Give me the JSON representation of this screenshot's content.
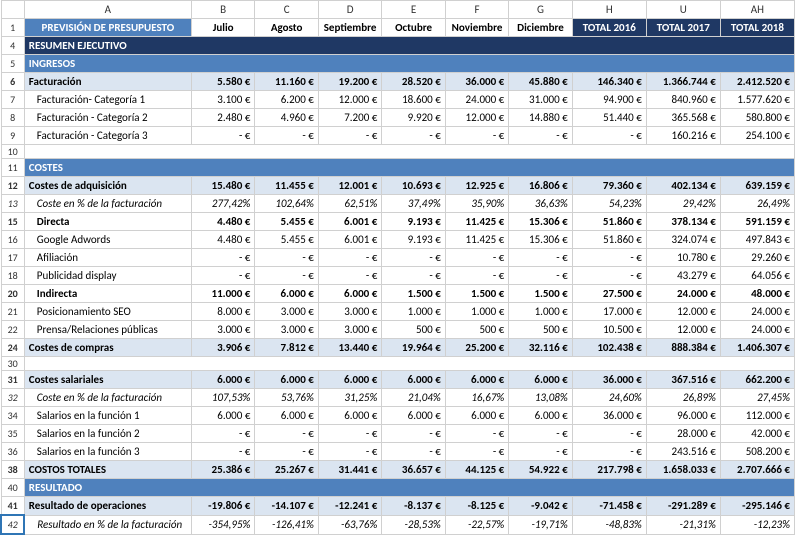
{
  "columns": [
    "A",
    "B",
    "C",
    "D",
    "E",
    "F",
    "G",
    "H",
    "U",
    "AH"
  ],
  "title": "PREVISIÓN DE PRESUPUESTO",
  "months": [
    "Julio",
    "Agosto",
    "Septiembre",
    "Octubre",
    "Noviembre",
    "Diciembre"
  ],
  "totals": [
    "TOTAL 2016",
    "TOTAL 2017",
    "TOTAL 2018"
  ],
  "sections": {
    "resumen": "RESUMEN EJECUTIVO",
    "ingresos": "INGRESOS",
    "costes": "COSTES",
    "resultado": "RESULTADO"
  },
  "rows": {
    "r6": {
      "label": "Facturación",
      "v": [
        "5.580 €",
        "11.160 €",
        "19.200 €",
        "28.520 €",
        "36.000 €",
        "45.880 €",
        "146.340 €",
        "1.366.744 €",
        "2.412.520 €"
      ]
    },
    "r7": {
      "label": "Facturación- Categoría 1",
      "v": [
        "3.100 €",
        "6.200 €",
        "12.000 €",
        "18.600 €",
        "24.000 €",
        "31.000 €",
        "94.900 €",
        "840.960 €",
        "1.577.620 €"
      ]
    },
    "r8": {
      "label": "Facturación - Categoría 2",
      "v": [
        "2.480 €",
        "4.960 €",
        "7.200 €",
        "9.920 €",
        "12.000 €",
        "14.880 €",
        "51.440 €",
        "365.568 €",
        "580.800 €"
      ]
    },
    "r9": {
      "label": "Facturación - Categoría 3",
      "v": [
        "-  €",
        "-  €",
        "-  €",
        "-  €",
        "-  €",
        "-  €",
        "-  €",
        "160.216 €",
        "254.100 €"
      ]
    },
    "r12": {
      "label": "Costes de adquisición",
      "v": [
        "15.480 €",
        "11.455 €",
        "12.001 €",
        "10.693 €",
        "12.925 €",
        "16.806 €",
        "79.360 €",
        "402.134 €",
        "639.159 €"
      ]
    },
    "r13": {
      "label": "Coste en % de la facturación",
      "v": [
        "277,42%",
        "102,64%",
        "62,51%",
        "37,49%",
        "35,90%",
        "36,63%",
        "54,23%",
        "29,42%",
        "26,49%"
      ]
    },
    "r15": {
      "label": "Directa",
      "v": [
        "4.480 €",
        "5.455 €",
        "6.001 €",
        "9.193 €",
        "11.425 €",
        "15.306 €",
        "51.860 €",
        "378.134 €",
        "591.159 €"
      ]
    },
    "r16": {
      "label": "Google Adwords",
      "v": [
        "4.480 €",
        "5.455 €",
        "6.001 €",
        "9.193 €",
        "11.425 €",
        "15.306 €",
        "51.860 €",
        "324.074 €",
        "497.843 €"
      ]
    },
    "r17": {
      "label": "Afiliación",
      "v": [
        "-  €",
        "-  €",
        "-  €",
        "-  €",
        "-  €",
        "-  €",
        "-  €",
        "10.780 €",
        "29.260 €"
      ]
    },
    "r18": {
      "label": "Publicidad display",
      "v": [
        "-  €",
        "-  €",
        "-  €",
        "-  €",
        "-  €",
        "-  €",
        "-  €",
        "43.279 €",
        "64.056 €"
      ]
    },
    "r20": {
      "label": "Indirecta",
      "v": [
        "11.000 €",
        "6.000 €",
        "6.000 €",
        "1.500 €",
        "1.500 €",
        "1.500 €",
        "27.500 €",
        "24.000 €",
        "48.000 €"
      ]
    },
    "r21": {
      "label": "Posicionamiento SEO",
      "v": [
        "8.000 €",
        "3.000 €",
        "3.000 €",
        "1.000 €",
        "1.000 €",
        "1.000 €",
        "17.000 €",
        "12.000 €",
        "24.000 €"
      ]
    },
    "r22": {
      "label": "Prensa/Relaciones públicas",
      "v": [
        "3.000 €",
        "3.000 €",
        "3.000 €",
        "500 €",
        "500 €",
        "500 €",
        "10.500 €",
        "12.000 €",
        "24.000 €"
      ]
    },
    "r24": {
      "label": "Costes de compras",
      "v": [
        "3.906 €",
        "7.812 €",
        "13.440 €",
        "19.964 €",
        "25.200 €",
        "32.116 €",
        "102.438 €",
        "888.384 €",
        "1.406.307 €"
      ]
    },
    "r31": {
      "label": "Costes salariales",
      "v": [
        "6.000 €",
        "6.000 €",
        "6.000 €",
        "6.000 €",
        "6.000 €",
        "6.000 €",
        "36.000 €",
        "367.516 €",
        "662.200 €"
      ]
    },
    "r32": {
      "label": "Coste en % de la facturación",
      "v": [
        "107,53%",
        "53,76%",
        "31,25%",
        "21,04%",
        "16,67%",
        "13,08%",
        "24,60%",
        "26,89%",
        "27,45%"
      ]
    },
    "r34": {
      "label": "Salarios en la función 1",
      "v": [
        "6.000 €",
        "6.000 €",
        "6.000 €",
        "6.000 €",
        "6.000 €",
        "6.000 €",
        "36.000 €",
        "96.000 €",
        "112.000 €"
      ]
    },
    "r35": {
      "label": "Salarios en la función 2",
      "v": [
        "-  €",
        "-  €",
        "-  €",
        "-  €",
        "-  €",
        "-  €",
        "-  €",
        "28.000 €",
        "42.000 €"
      ]
    },
    "r36": {
      "label": "Salarios en la función 3",
      "v": [
        "-  €",
        "-  €",
        "-  €",
        "-  €",
        "-  €",
        "-  €",
        "-  €",
        "243.516 €",
        "508.200 €"
      ]
    },
    "r38": {
      "label": "COSTOS TOTALES",
      "v": [
        "25.386 €",
        "25.267 €",
        "31.441 €",
        "36.657 €",
        "44.125 €",
        "54.922 €",
        "217.798 €",
        "1.658.033 €",
        "2.707.666 €"
      ]
    },
    "r41": {
      "label": "Resultado de operaciones",
      "v": [
        "-19.806 €",
        "-14.107 €",
        "-12.241 €",
        "-8.137 €",
        "-8.125 €",
        "-9.042 €",
        "-71.458 €",
        "-291.289 €",
        "-295.146 €"
      ]
    },
    "r42": {
      "label": "Resultado en % de la facturación",
      "v": [
        "-354,95%",
        "-126,41%",
        "-63,76%",
        "-28,53%",
        "-22,57%",
        "-19,71%",
        "-48,83%",
        "-21,31%",
        "-12,23%"
      ]
    }
  },
  "chart_data": {
    "type": "table",
    "title": "PREVISIÓN DE PRESUPUESTO",
    "columns": [
      "Julio",
      "Agosto",
      "Septiembre",
      "Octubre",
      "Noviembre",
      "Diciembre",
      "TOTAL 2016",
      "TOTAL 2017",
      "TOTAL 2018"
    ],
    "rows": [
      {
        "name": "Facturación",
        "values": [
          5580,
          11160,
          19200,
          28520,
          36000,
          45880,
          146340,
          1366744,
          2412520
        ]
      },
      {
        "name": "Costes de adquisición",
        "values": [
          15480,
          11455,
          12001,
          10693,
          12925,
          16806,
          79360,
          402134,
          639159
        ]
      },
      {
        "name": "Costes de compras",
        "values": [
          3906,
          7812,
          13440,
          19964,
          25200,
          32116,
          102438,
          888384,
          1406307
        ]
      },
      {
        "name": "Costes salariales",
        "values": [
          6000,
          6000,
          6000,
          6000,
          6000,
          6000,
          36000,
          367516,
          662200
        ]
      },
      {
        "name": "COSTOS TOTALES",
        "values": [
          25386,
          25267,
          31441,
          36657,
          44125,
          54922,
          217798,
          1658033,
          2707666
        ]
      },
      {
        "name": "Resultado de operaciones",
        "values": [
          -19806,
          -14107,
          -12241,
          -8137,
          -8125,
          -9042,
          -71458,
          -291289,
          -295146
        ]
      }
    ]
  }
}
